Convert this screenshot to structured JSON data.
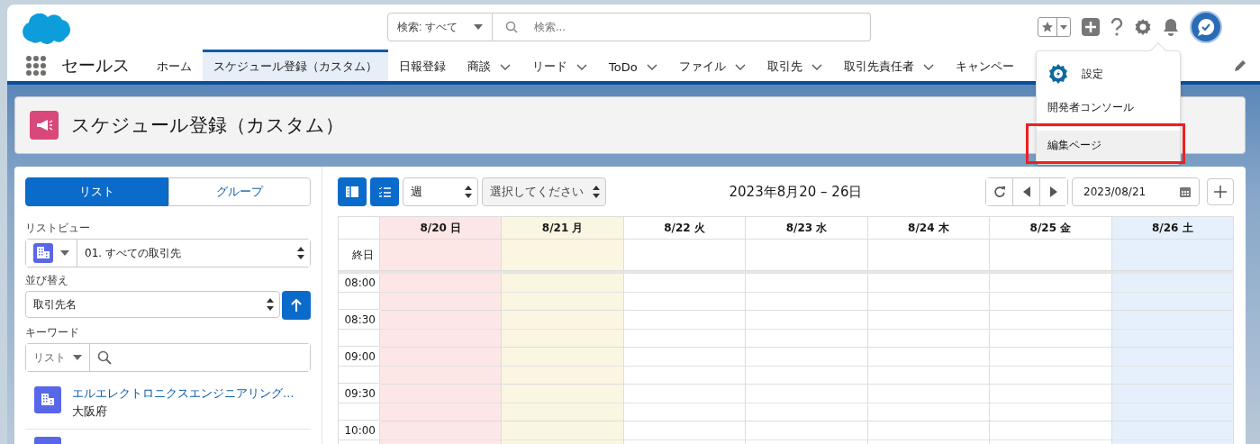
{
  "header": {
    "search": {
      "scope": "検索: すべて",
      "placeholder": "検索..."
    }
  },
  "nav": {
    "app_name": "セールス",
    "tabs": [
      {
        "label": "ホーム",
        "selected": false,
        "has_menu": false
      },
      {
        "label": "スケジュール登録（カスタム）",
        "selected": true,
        "has_menu": false
      },
      {
        "label": "日報登録",
        "selected": false,
        "has_menu": false
      },
      {
        "label": "商談",
        "selected": false,
        "has_menu": true
      },
      {
        "label": "リード",
        "selected": false,
        "has_menu": true
      },
      {
        "label": "ToDo",
        "selected": false,
        "has_menu": true
      },
      {
        "label": "ファイル",
        "selected": false,
        "has_menu": true
      },
      {
        "label": "取引先",
        "selected": false,
        "has_menu": true
      },
      {
        "label": "取引先責任者",
        "selected": false,
        "has_menu": true
      },
      {
        "label": "キャンペー",
        "selected": false,
        "has_menu": false
      }
    ]
  },
  "settings_menu": [
    {
      "label": "設定",
      "kind": "icon",
      "selected": false,
      "annotated": false
    },
    {
      "label": "開発者コンソール",
      "kind": "plain",
      "selected": false,
      "annotated": false
    },
    {
      "label": "編集ページ",
      "kind": "plain",
      "selected": true,
      "annotated": true
    }
  ],
  "page_title": "スケジュール登録（カスタム）",
  "sidebar": {
    "tabs": [
      {
        "label": "リスト",
        "selected": true
      },
      {
        "label": "グループ",
        "selected": false
      }
    ],
    "list_view": {
      "label": "リストビュー",
      "value": "01. すべての取引先"
    },
    "sort": {
      "label": "並び替え",
      "value": "取引先名"
    },
    "keyword": {
      "label": "キーワード",
      "scope": "リスト"
    },
    "records": [
      {
        "name": "エルエレクトロニクスエンジニアリング…",
        "region": "大阪府"
      }
    ]
  },
  "calendar": {
    "view": "週",
    "filter": "選択してください",
    "title": "2023年8月20 – 26日",
    "date": "2023/08/21",
    "all_day_label": "終日",
    "days": [
      {
        "label": "8/20 日",
        "kind": "sunday"
      },
      {
        "label": "8/21 月",
        "kind": "today"
      },
      {
        "label": "8/22 火",
        "kind": "weekday"
      },
      {
        "label": "8/23 水",
        "kind": "weekday"
      },
      {
        "label": "8/24 木",
        "kind": "weekday"
      },
      {
        "label": "8/25 金",
        "kind": "weekday"
      },
      {
        "label": "8/26 土",
        "kind": "saturday"
      }
    ],
    "times": [
      "08:00",
      "08:30",
      "09:00",
      "09:30",
      "10:00"
    ]
  }
}
